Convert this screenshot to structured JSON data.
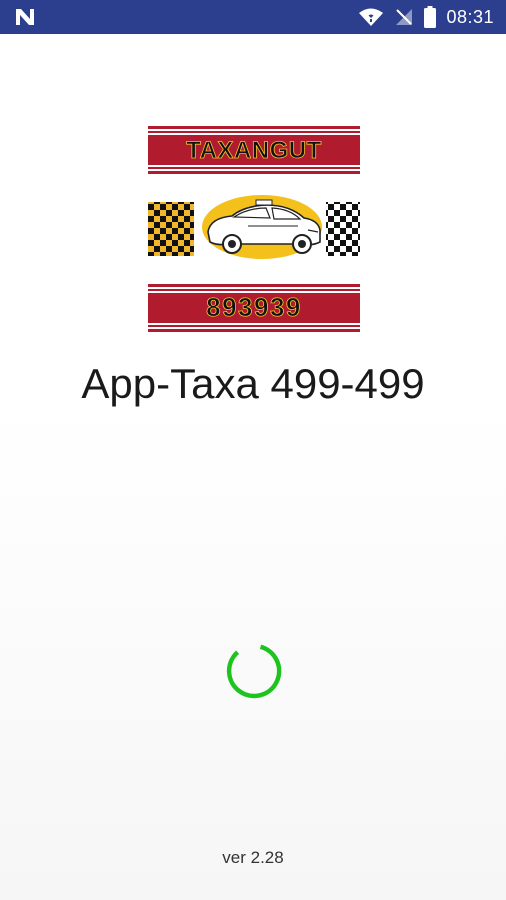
{
  "status_bar": {
    "time": "08:31",
    "notification_icon": "n-icon",
    "wifi_icon": "wifi-icon",
    "signal_icon": "no-signal-icon",
    "battery_icon": "battery-icon",
    "background_color": "#2c3f8f"
  },
  "logo": {
    "top_text": "TAXANGUT",
    "bottom_text": "893939",
    "band_color": "#b01c2e",
    "oval_color": "#f4c11c",
    "icon": "taxi-car-icon"
  },
  "app_title": "App-Taxa 499-499",
  "loading": {
    "icon": "loading-spinner-icon",
    "color": "#1ec41e"
  },
  "version": "ver 2.28"
}
